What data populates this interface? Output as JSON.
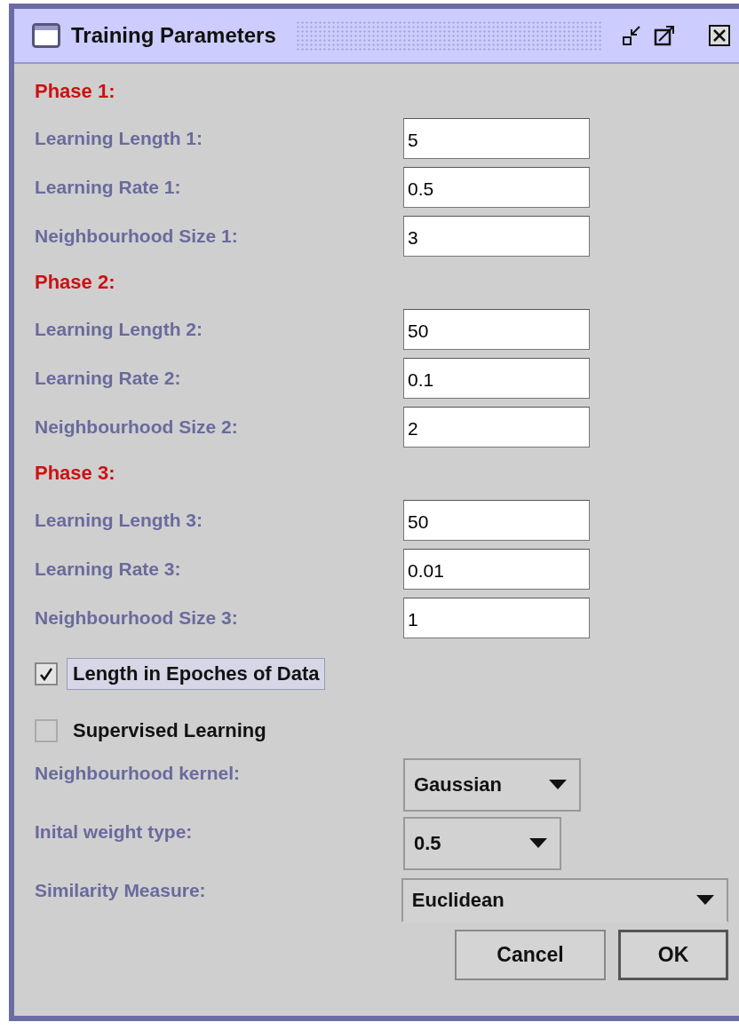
{
  "window": {
    "title": "Training Parameters"
  },
  "items": [
    {
      "kind": "heading",
      "label": "Phase 1:"
    },
    {
      "kind": "field",
      "label": "Learning Length 1:",
      "value": "5"
    },
    {
      "kind": "field",
      "label": "Learning Rate 1:",
      "value": "0.5"
    },
    {
      "kind": "field",
      "label": "Neighbourhood Size 1:",
      "value": "3"
    },
    {
      "kind": "heading",
      "label": "Phase 2:"
    },
    {
      "kind": "field",
      "label": "Learning Length 2:",
      "value": "50"
    },
    {
      "kind": "field",
      "label": "Learning Rate 2:",
      "value": "0.1"
    },
    {
      "kind": "field",
      "label": "Neighbourhood Size 2:",
      "value": "2"
    },
    {
      "kind": "heading",
      "label": "Phase 3:"
    },
    {
      "kind": "field",
      "label": "Learning Length 3:",
      "value": "50"
    },
    {
      "kind": "field",
      "label": "Learning Rate 3:",
      "value": "0.01"
    },
    {
      "kind": "field",
      "label": "Neighbourhood Size 3:",
      "value": "1"
    },
    {
      "kind": "checkbox",
      "label": "Length in Epoches of Data",
      "checked": true,
      "focused": true
    },
    {
      "kind": "checkbox",
      "label": "Supervised Learning",
      "checked": false,
      "focused": false
    },
    {
      "kind": "dropdown",
      "label": "Neighbourhood kernel:",
      "value": "Gaussian"
    },
    {
      "kind": "dropdown",
      "label": "Inital weight type:",
      "value": "0.5"
    },
    {
      "kind": "dropdown",
      "label": "Similarity Measure:",
      "value": "Euclidean"
    }
  ],
  "buttons": [
    {
      "label": "Cancel",
      "default": false
    },
    {
      "label": "OK",
      "default": true
    }
  ]
}
